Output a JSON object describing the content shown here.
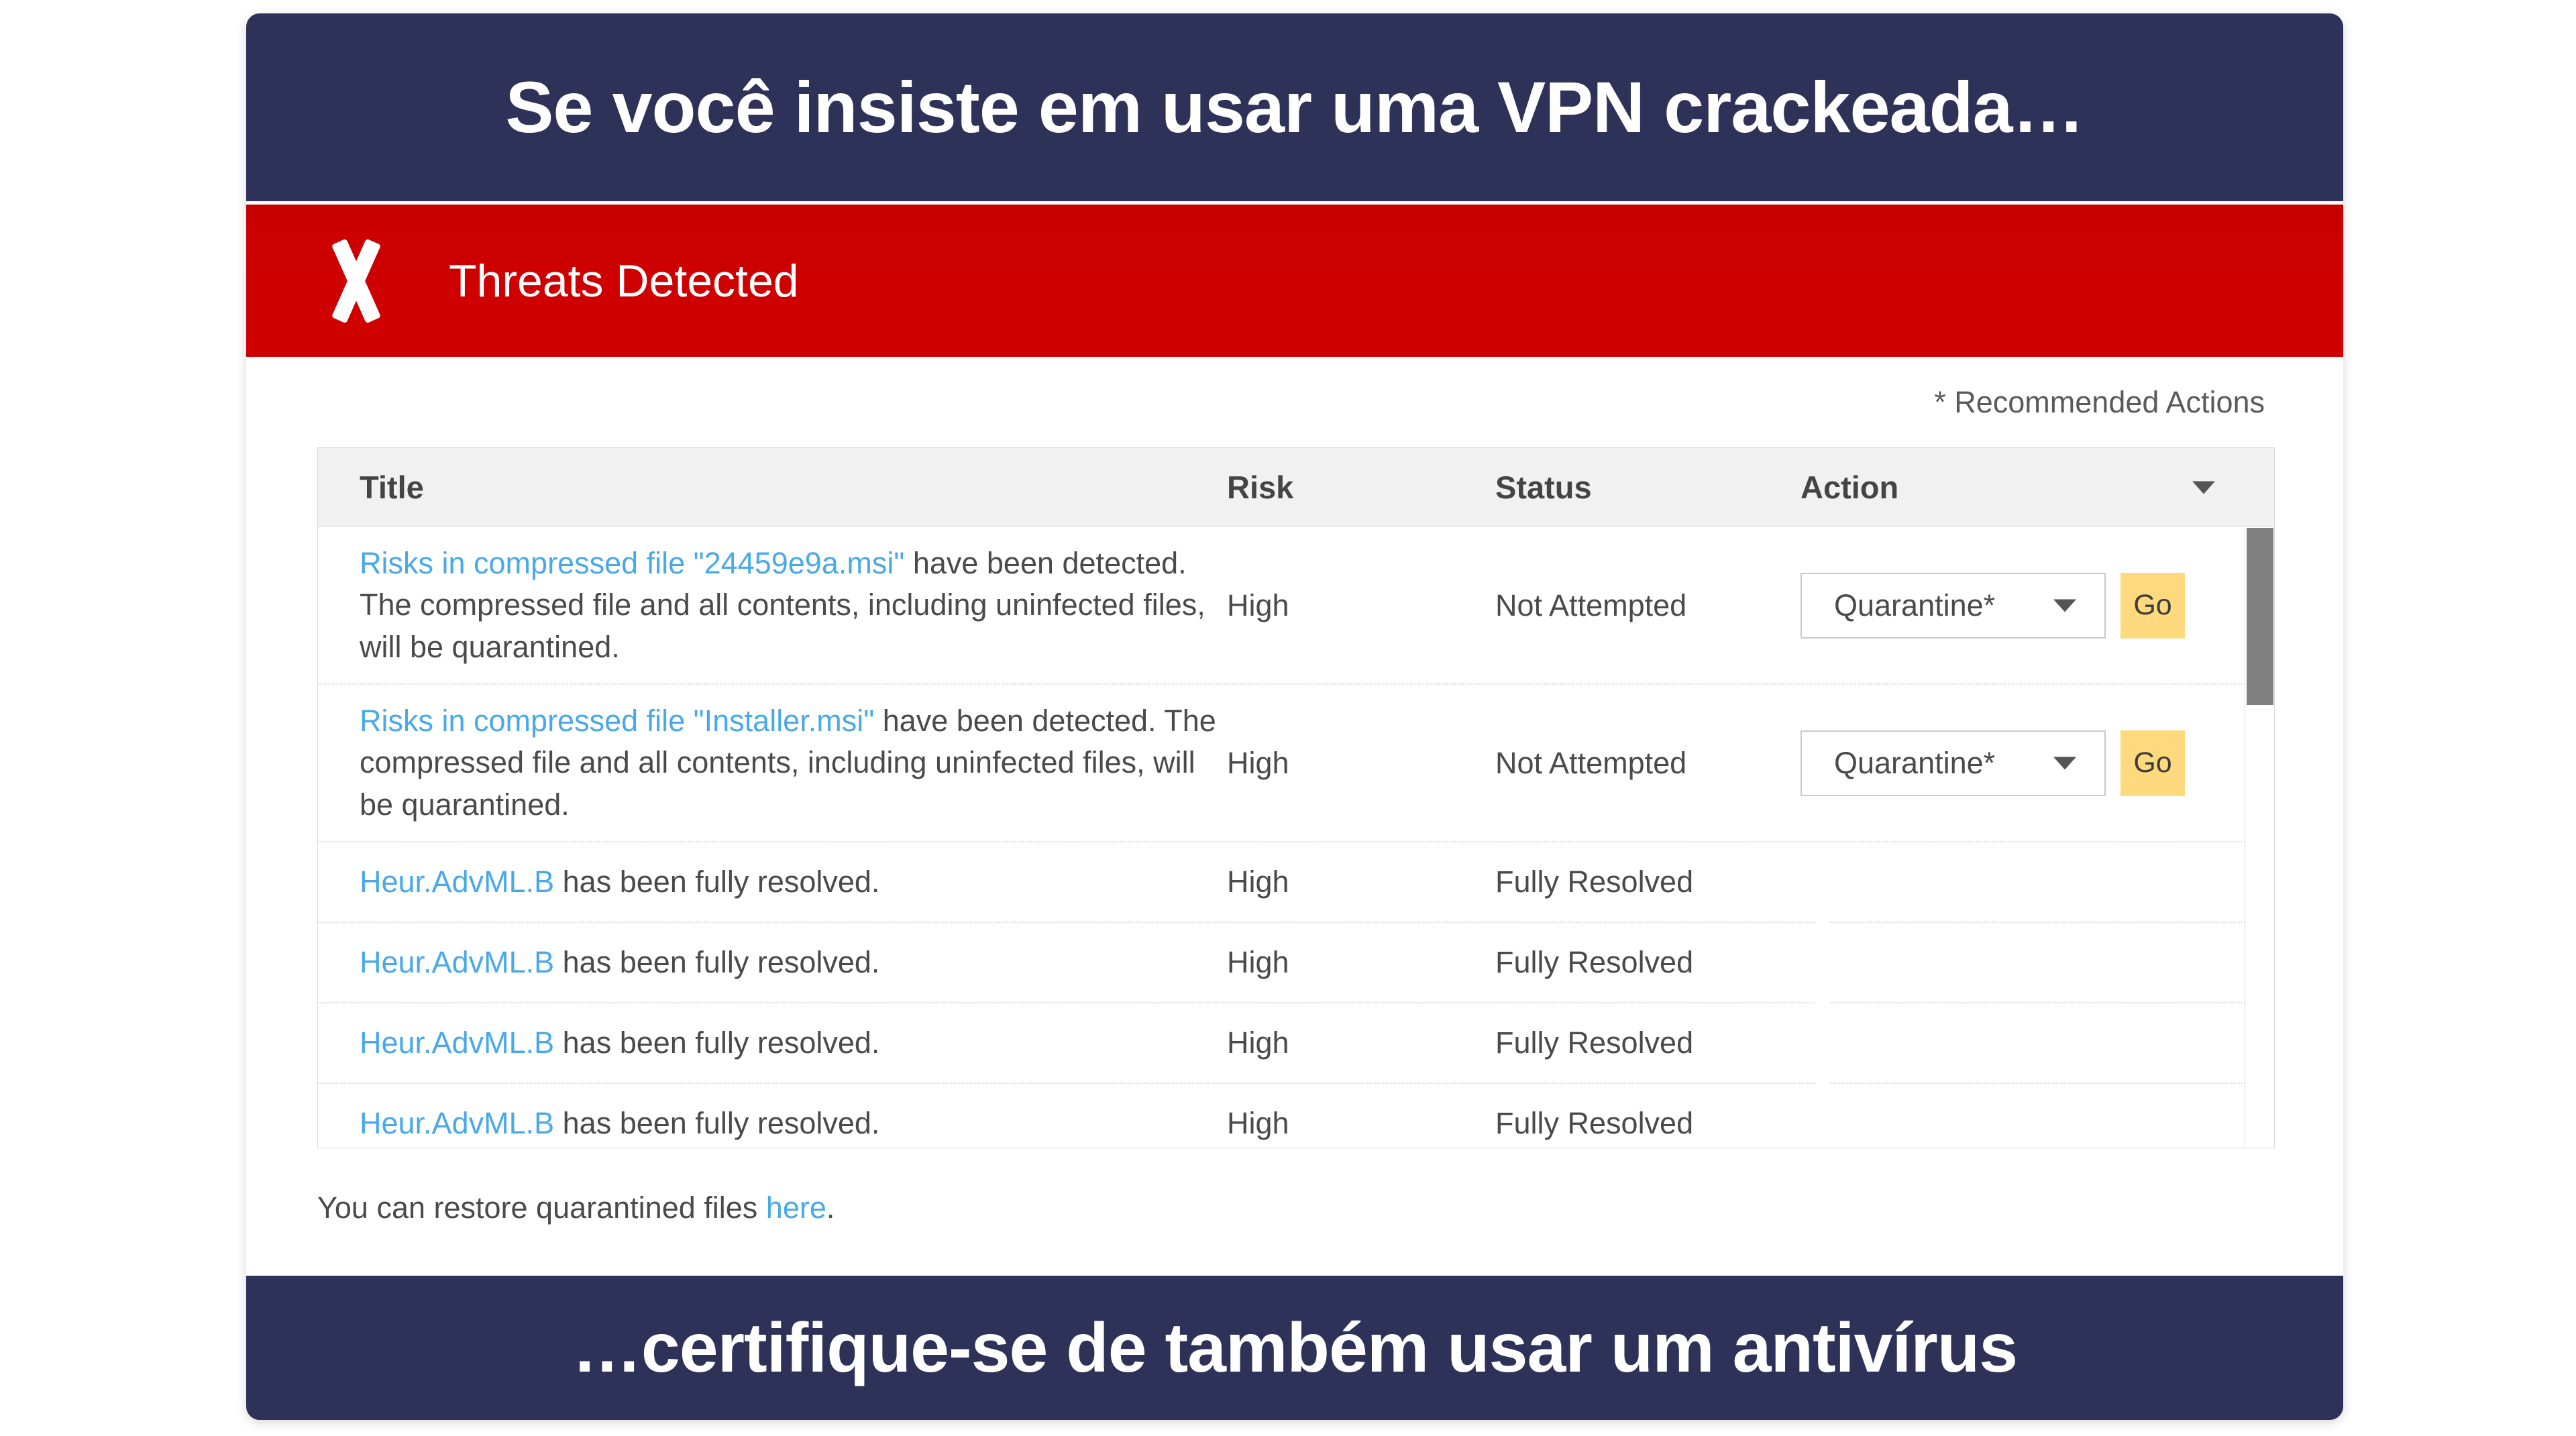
{
  "caption": {
    "top": "Se você insiste em usar uma VPN crackeada…",
    "bottom": "…certifique-se de também usar um antivírus"
  },
  "alert": {
    "icon": "x-mark-icon",
    "title": "Threats Detected",
    "bar_color": "#CC0000"
  },
  "notes": {
    "recommended_actions": "* Recommended Actions",
    "restore_prefix": "You can restore quarantined files ",
    "restore_link": "here",
    "restore_suffix": "."
  },
  "table": {
    "columns": [
      "Title",
      "Risk",
      "Status",
      "Action"
    ],
    "sort_caret": "chevron-down-icon",
    "rows": [
      {
        "title_link": "Risks in compressed file \"24459e9a.msi\"",
        "title_rest": " have been detected. The compressed file and all contents, including uninfected files, will be quarantined.",
        "risk": "High",
        "status": "Not Attempted",
        "action_type": "select",
        "action_value": "Quarantine*",
        "action_button": "Go"
      },
      {
        "title_link": "Risks in compressed file \"Installer.msi\"",
        "title_rest": " have been detected. The compressed file and all contents, including uninfected files, will be quarantined.",
        "risk": "High",
        "status": "Not Attempted",
        "action_type": "select",
        "action_value": "Quarantine*",
        "action_button": "Go"
      },
      {
        "title_link": "Heur.AdvML.B",
        "title_rest": " has been fully resolved.",
        "risk": "High",
        "status": "Fully Resolved",
        "action_type": "check"
      },
      {
        "title_link": "Heur.AdvML.B",
        "title_rest": " has been fully resolved.",
        "risk": "High",
        "status": "Fully Resolved",
        "action_type": "check"
      },
      {
        "title_link": "Heur.AdvML.B",
        "title_rest": " has been fully resolved.",
        "risk": "High",
        "status": "Fully Resolved",
        "action_type": "check"
      },
      {
        "title_link": "Heur.AdvML.B",
        "title_rest": " has been fully resolved.",
        "risk": "High",
        "status": "Fully Resolved",
        "action_type": "check"
      }
    ]
  },
  "colors": {
    "banner": "#2E3258",
    "alert_red": "#CC0000",
    "link_blue": "#49A9E8",
    "go_yellow": "#FFD97D",
    "check_green": "#3B9B3B",
    "scrollbar": "#808080"
  }
}
